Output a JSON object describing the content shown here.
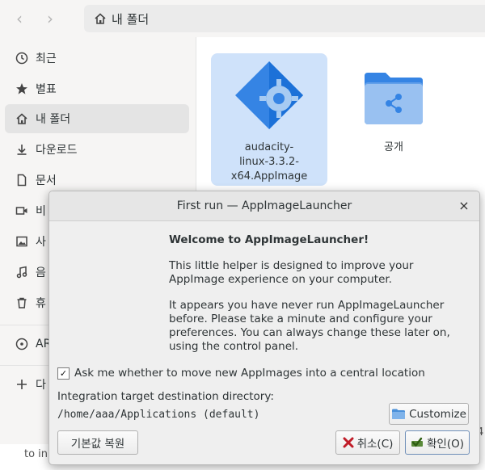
{
  "file_manager": {
    "path_label": "내 폴더",
    "sidebar": {
      "items": [
        {
          "label": "최근",
          "icon": "clock-icon"
        },
        {
          "label": "별표",
          "icon": "star-icon"
        },
        {
          "label": "내 폴더",
          "icon": "home-icon"
        },
        {
          "label": "다운로드",
          "icon": "download-icon"
        },
        {
          "label": "문서",
          "icon": "document-icon"
        },
        {
          "label": "비",
          "icon": "video-icon"
        },
        {
          "label": "사",
          "icon": "picture-icon"
        },
        {
          "label": "음",
          "icon": "music-icon"
        },
        {
          "label": "휴",
          "icon": "trash-icon"
        },
        {
          "label": "AR",
          "icon": "disc-icon"
        },
        {
          "label": "다",
          "icon": "plus-icon"
        }
      ]
    },
    "files": [
      {
        "name_lines": [
          "audacity-",
          "linux-3.3.2-",
          "x64.AppImage"
        ],
        "icon": "appimage-icon"
      },
      {
        "name_lines": [
          "공개"
        ],
        "icon": "shared-folder-icon"
      }
    ],
    "bottom_text": "to in",
    "right_edge_text": "4"
  },
  "dialog": {
    "title": "First run — AppImageLauncher",
    "heading": "Welcome to AppImageLauncher!",
    "paragraph1": "This little helper is designed to improve your AppImage experience on your computer.",
    "paragraph2": "It appears you have never run AppImageLauncher before. Please take a minute and configure your preferences. You can always change these later on, using the control panel.",
    "checkbox_label": "Ask me whether to move new AppImages into a central location",
    "checkbox_mark": "✓",
    "checkbox_checked": true,
    "target_label": "Integration target destination directory:",
    "target_value": "/home/aaa/Applications (default)",
    "customize_label": "Customize",
    "restore_label": "기본값 복원",
    "cancel_label": "취소(C)",
    "ok_label": "확인(O)"
  },
  "colors": {
    "selection": "#cfe2fa",
    "folder_blue": "#62a0ea",
    "appimage_blue": "#3584e4"
  }
}
